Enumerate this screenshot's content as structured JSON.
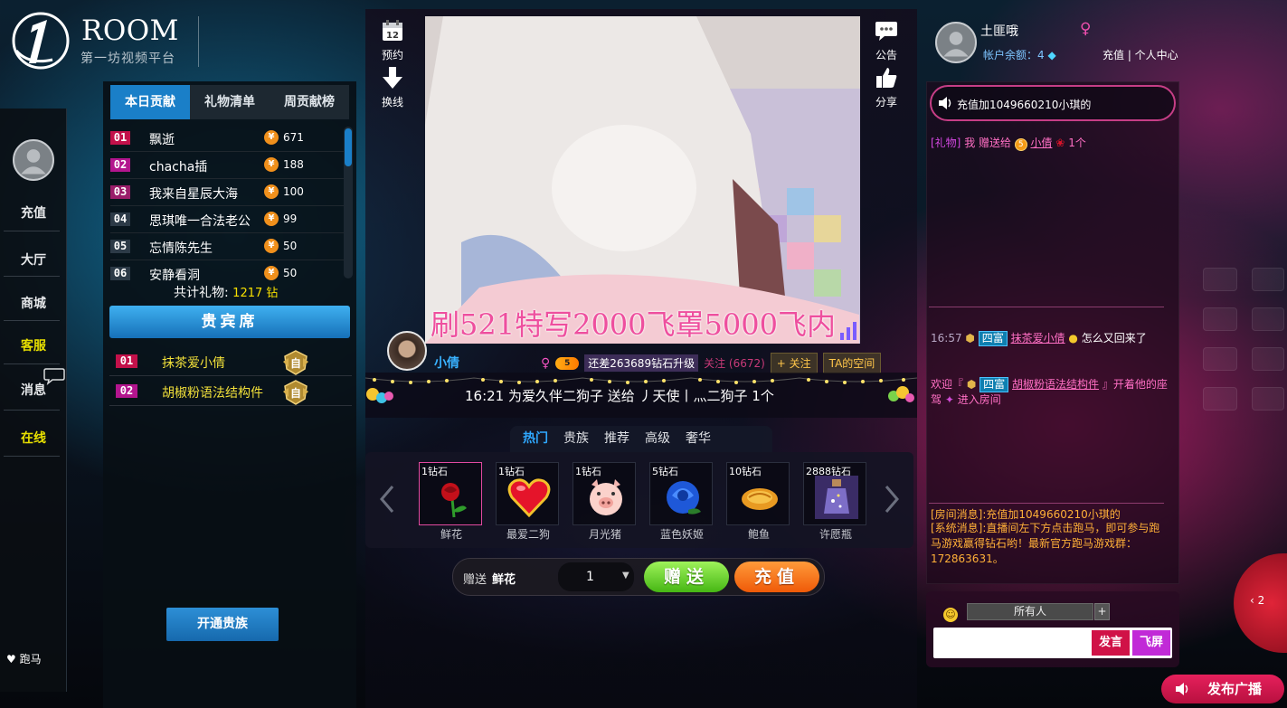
{
  "logo": {
    "brand": "ROOM",
    "slogan": "第一坊视频平台"
  },
  "leftnav": {
    "items": [
      {
        "label": "充值",
        "accent": false
      },
      {
        "label": "大厅",
        "accent": false
      },
      {
        "label": "商城",
        "accent": false
      },
      {
        "label": "客服",
        "accent": true
      },
      {
        "label": "消息",
        "accent": false
      },
      {
        "label": "在线",
        "accent": true
      }
    ],
    "horse_race": "跑马"
  },
  "ranking": {
    "tabs": [
      "本日贡献",
      "礼物清单",
      "周贡献榜"
    ],
    "active_tab": 0,
    "rows": [
      {
        "rank": "01",
        "name": "飘逝",
        "value": "671"
      },
      {
        "rank": "02",
        "name": "chacha插",
        "value": "188"
      },
      {
        "rank": "03",
        "name": "我来自星辰大海",
        "value": "100"
      },
      {
        "rank": "04",
        "name": "思琪唯一合法老公",
        "value": "99"
      },
      {
        "rank": "05",
        "name": "忘情陈先生",
        "value": "50"
      },
      {
        "rank": "06",
        "name": "安静看洞",
        "value": "50"
      }
    ],
    "coin_glyph": "¥",
    "total_label": "共计礼物:",
    "total_value": "1217 钻"
  },
  "vip": {
    "title": "贵宾席",
    "rows": [
      {
        "rank": "01",
        "name": "抹茶爱小倩"
      },
      {
        "rank": "02",
        "name": "胡椒粉语法结构件"
      }
    ],
    "badge_char": "自"
  },
  "noble_button": "开通贵族",
  "center": {
    "tools_left": [
      {
        "icon": "calendar-icon",
        "label": "预约",
        "calendar_num": "12"
      },
      {
        "icon": "download-arrow-icon",
        "label": "换线"
      }
    ],
    "tools_right": [
      {
        "icon": "speech-bubble-icon",
        "label": "公告"
      },
      {
        "icon": "thumbs-up-icon",
        "label": "分享"
      }
    ],
    "video_caption": "刷521特写2000飞罩5000飞内",
    "anchor": {
      "name": "小倩",
      "gender": "♀",
      "level": "5",
      "upgrade_text": "还差263689钻石升级",
      "follow_count": "关注 (6672)",
      "follow_button": "+ 关注",
      "space_button": "TA的空间"
    },
    "marquee": "16:21  为爱久伴二狗子 送给 丿天使丨灬二狗子   1个"
  },
  "gifts": {
    "tabs": [
      "热门",
      "贵族",
      "推荐",
      "高级",
      "奢华"
    ],
    "active_tab": 0,
    "items": [
      {
        "price": "1钻石",
        "name": "鲜花",
        "icon": "rose-icon",
        "selected": true
      },
      {
        "price": "1钻石",
        "name": "最爱二狗",
        "icon": "heart-icon",
        "selected": false
      },
      {
        "price": "1钻石",
        "name": "月光猪",
        "icon": "pig-icon",
        "selected": false
      },
      {
        "price": "5钻石",
        "name": "蓝色妖姬",
        "icon": "blue-rose-icon",
        "selected": false
      },
      {
        "price": "10钻石",
        "name": "鲍鱼",
        "icon": "abalone-icon",
        "selected": false
      },
      {
        "price": "2888钻石",
        "name": "许愿瓶",
        "icon": "wish-bottle-icon",
        "selected": false
      }
    ]
  },
  "sendbar": {
    "label": "赠送",
    "selected_gift": "鲜花",
    "quantity": "1",
    "dropdown_glyph": "▼",
    "give_button": "赠送",
    "recharge_button": "充值"
  },
  "user": {
    "name": "土匪哦",
    "gender": "♀",
    "balance": "帐户余额：4",
    "links": "充值 | 个人中心"
  },
  "chat": {
    "announcement": "充值加1049660210小琪的",
    "gift_msg": {
      "tag": "[礼物]",
      "me": "我",
      "verb": "赠送给",
      "level": "5",
      "target": "小倩",
      "count": "1个"
    },
    "msg1": {
      "time": "16:57",
      "rich": "四富",
      "user": "抹茶爱小倩",
      "text": "怎么又回来了"
    },
    "msg2": {
      "prefix": "欢迎『",
      "rich": "四富",
      "user": "胡椒粉语法结构件",
      "mid": "』开着他的座驾",
      "suffix": "进入房间"
    },
    "system1": "[房间消息]:充值加1049660210小琪的",
    "system2": "[系统消息]:直播间左下方点击跑马，即可参与跑马游戏赢得钻石哟！最新官方跑马游戏群：172863631。",
    "target": "所有人",
    "target_plus": "+",
    "speak_button": "发言",
    "fly_button": "飞屏",
    "broadcast_button": "发布广播",
    "collapse_label": "‹ 2"
  },
  "colors": {
    "accent_blue": "#1a7fc8",
    "vip_yellow": "#f2e13a",
    "pink": "#ee4f9e",
    "give_green": "#46b714",
    "recharge_orange": "#ef5a08",
    "speak_red": "#d01247",
    "fly_purple": "#c12ad7"
  }
}
